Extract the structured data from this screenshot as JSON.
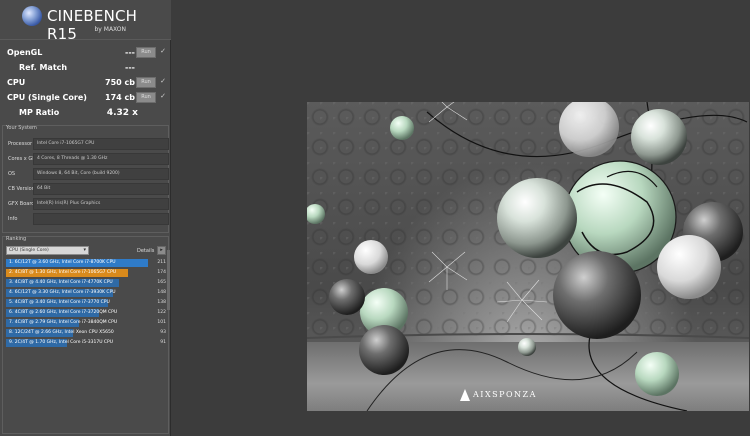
{
  "app": {
    "title": "CINEBENCH R15",
    "subtitle": "by MAXON"
  },
  "scores": {
    "run_label": "Run",
    "opengl": {
      "label": "OpenGL",
      "value": "---"
    },
    "ref_match": {
      "label": "Ref. Match",
      "value": "---"
    },
    "cpu": {
      "label": "CPU",
      "value": "750 cb"
    },
    "cpu_single": {
      "label": "CPU (Single Core)",
      "value": "174 cb"
    },
    "mp_ratio": {
      "label": "MP Ratio",
      "value": "4.32 x"
    }
  },
  "your_system": {
    "title": "Your System",
    "rows": [
      {
        "key": "Processor",
        "value": "Intel Core i7-1065G7 CPU"
      },
      {
        "key": "Cores x GHz",
        "value": "4 Cores, 8 Threads @ 1.30 GHz"
      },
      {
        "key": "OS",
        "value": "Windows 8, 64 Bit, Core (build 9200)"
      },
      {
        "key": "CB Version",
        "value": "64 Bit"
      },
      {
        "key": "GFX Board",
        "value": "Intel(R) Iris(R) Plus Graphics"
      },
      {
        "key": "Info",
        "value": ""
      }
    ]
  },
  "ranking": {
    "title": "Ranking",
    "selected": "CPU (Single Core)",
    "details_label": "Details",
    "rows": [
      {
        "text": "1. 6C/12T @ 3.60 GHz, Intel Core i7-8700K CPU",
        "score": "211",
        "frac": 0.98,
        "kind": "hi"
      },
      {
        "text": "2. 4C/8T @ 1.30 GHz, Intel Core i7-1065G7 CPU",
        "score": "174",
        "frac": 0.84,
        "kind": "you"
      },
      {
        "text": "3. 4C/8T @ 4.40 GHz, Intel Core i7-4770K CPU",
        "score": "165",
        "frac": 0.78,
        "kind": ""
      },
      {
        "text": "4. 6C/12T @ 3.30 GHz, Intel Core i7-3930K CPU",
        "score": "148",
        "frac": 0.74,
        "kind": ""
      },
      {
        "text": "5. 4C/8T @ 3.40 GHz, Intel Core i7-3770 CPU",
        "score": "138",
        "frac": 0.7,
        "kind": ""
      },
      {
        "text": "6. 4C/8T @ 2.60 GHz, Intel Core i7-3720QM CPU",
        "score": "122",
        "frac": 0.64,
        "kind": ""
      },
      {
        "text": "7. 4C/8T @ 2.79 GHz, Intel Core i7-3840QM CPU",
        "score": "101",
        "frac": 0.5,
        "kind": ""
      },
      {
        "text": "8. 12C/24T @ 2.66 GHz, Intel Xeon CPU X5650",
        "score": "93",
        "frac": 0.46,
        "kind": ""
      },
      {
        "text": "9. 2C/4T @ 1.70 GHz, Intel Core i5-3317U CPU",
        "score": "91",
        "frac": 0.42,
        "kind": ""
      }
    ]
  },
  "render": {
    "watermark": "AIXSPONZA"
  }
}
